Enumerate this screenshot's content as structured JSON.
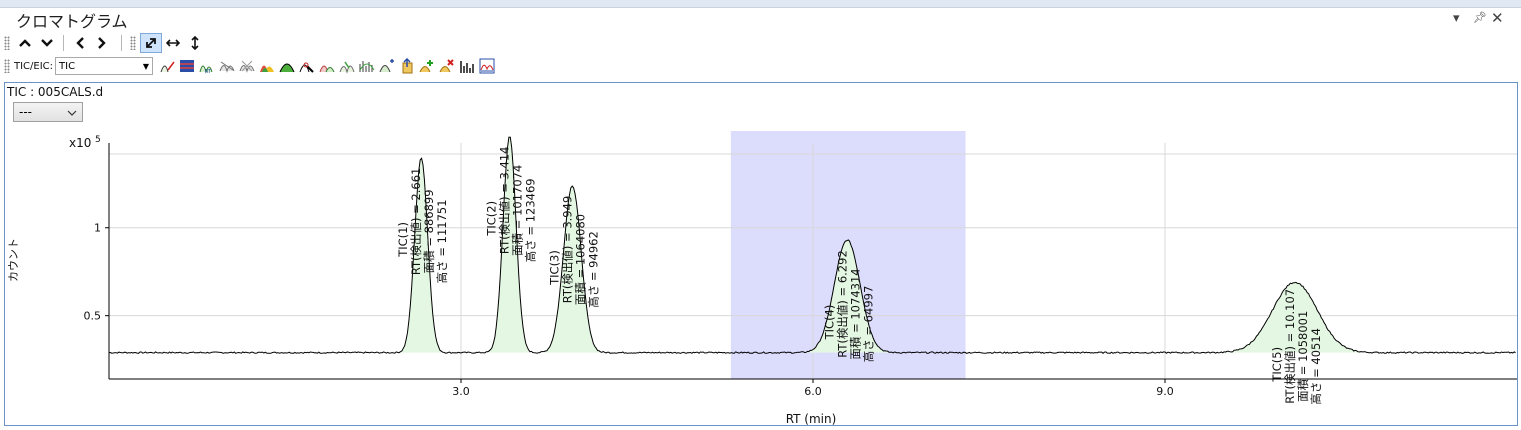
{
  "window": {
    "title": "クロマトグラム",
    "pin_glyph": "▾",
    "pushpin_glyph": "🖈",
    "close_glyph": "✕"
  },
  "toolbar_nav": {
    "items": [
      "up-arrow-icon",
      "down-arrow-icon",
      "left-arrow-icon",
      "right-arrow-icon"
    ],
    "glyphs": [
      "⌃",
      "⌄",
      "‹",
      "›"
    ],
    "zoom_glyphs": [
      "⤢",
      "↔",
      "↕"
    ]
  },
  "toolbar_tic": {
    "label": "TIC/EIC:",
    "selected": "TIC",
    "icons": [
      "integrate-icon",
      "table-icon",
      "peak-label-icon",
      "baseline-icon",
      "clear-baseline-icon",
      "color-peaks-icon",
      "peak-icon",
      "peak-find-icon",
      "manual-peak-icon",
      "spectrum-icon",
      "deconvolution-icon",
      "export-icon",
      "add-peak-icon",
      "delete-peak-icon",
      "bar-spectrum-icon",
      "overlay-icon"
    ]
  },
  "panel": {
    "dataset_label": "TIC : 005CALS.d",
    "dropdown_value": "---"
  },
  "chart_data": {
    "type": "line",
    "title": "",
    "xlabel": "RT (min)",
    "ylabel": "カウント",
    "exponent_label": "x10",
    "exponent_power": "5",
    "xlim": [
      0.0,
      12.0
    ],
    "ylim": [
      0.14,
      1.55
    ],
    "x_ticks": [
      {
        "value": 3.0,
        "label": "3.0"
      },
      {
        "value": 6.0,
        "label": "6.0"
      },
      {
        "value": 9.0,
        "label": "9.0"
      }
    ],
    "y_ticks": [
      {
        "value": 0.5,
        "label": "0.5"
      },
      {
        "value": 1.0,
        "label": "1"
      }
    ],
    "grid": true,
    "baseline": 0.29,
    "highlight_range": [
      5.3,
      7.3
    ],
    "highlight_color": "#dcdcfc",
    "peak_fill_color": "#e3f7e3",
    "line_color": "#000000",
    "peaks": [
      {
        "label": "TIC(1)",
        "rt_text": "RT(検出値) = 2.661",
        "area_text": "面積 = 886899",
        "height_text": "高さ = 111751",
        "rt": 2.661,
        "apex": 1.4,
        "sigma": 0.055
      },
      {
        "label": "TIC(2)",
        "rt_text": "RT(検出値) = 3.414",
        "area_text": "面積 = 1017074",
        "height_text": "高さ = 123469",
        "rt": 3.414,
        "apex": 1.52,
        "sigma": 0.055
      },
      {
        "label": "TIC(3)",
        "rt_text": "RT(検出値) = 3.949",
        "area_text": "面積 = 1064080",
        "height_text": "高さ = 94962",
        "rt": 3.949,
        "apex": 1.24,
        "sigma": 0.075
      },
      {
        "label": "TIC(4)",
        "rt_text": "RT(検出値) = 6.292",
        "area_text": "面積 = 1074314",
        "height_text": "高さ = 64997",
        "rt": 6.292,
        "apex": 0.93,
        "sigma": 0.11
      },
      {
        "label": "TIC(5)",
        "rt_text": "RT(検出値) = 10.107",
        "area_text": "面積 = 1058001",
        "height_text": "高さ = 40514",
        "rt": 10.107,
        "apex": 0.69,
        "sigma": 0.19
      }
    ]
  }
}
